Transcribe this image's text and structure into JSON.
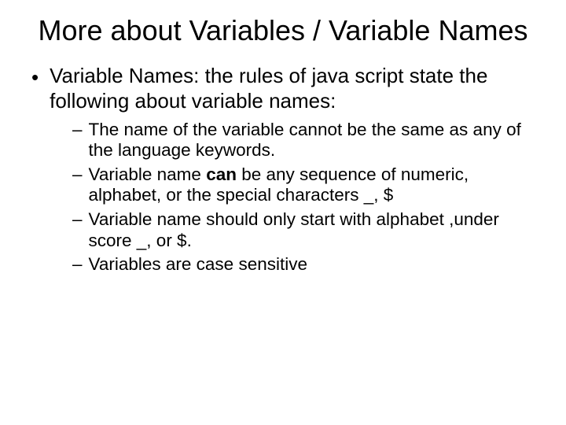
{
  "title": "More about Variables / Variable Names",
  "main_bullet": {
    "marker": "•",
    "text": "Variable Names: the rules of java script state the following about variable names:"
  },
  "sub_bullets": [
    {
      "marker": "–",
      "text": "The name of the variable cannot be the same as any of the language keywords."
    },
    {
      "marker": "–",
      "prefix": "Variable name ",
      "bold": "can",
      "suffix": " be any sequence of numeric, alphabet, or the special characters _, $"
    },
    {
      "marker": "–",
      "text": "Variable name should only start with alphabet ,under score _, or $."
    },
    {
      "marker": "–",
      "text": "Variables are case sensitive"
    }
  ]
}
